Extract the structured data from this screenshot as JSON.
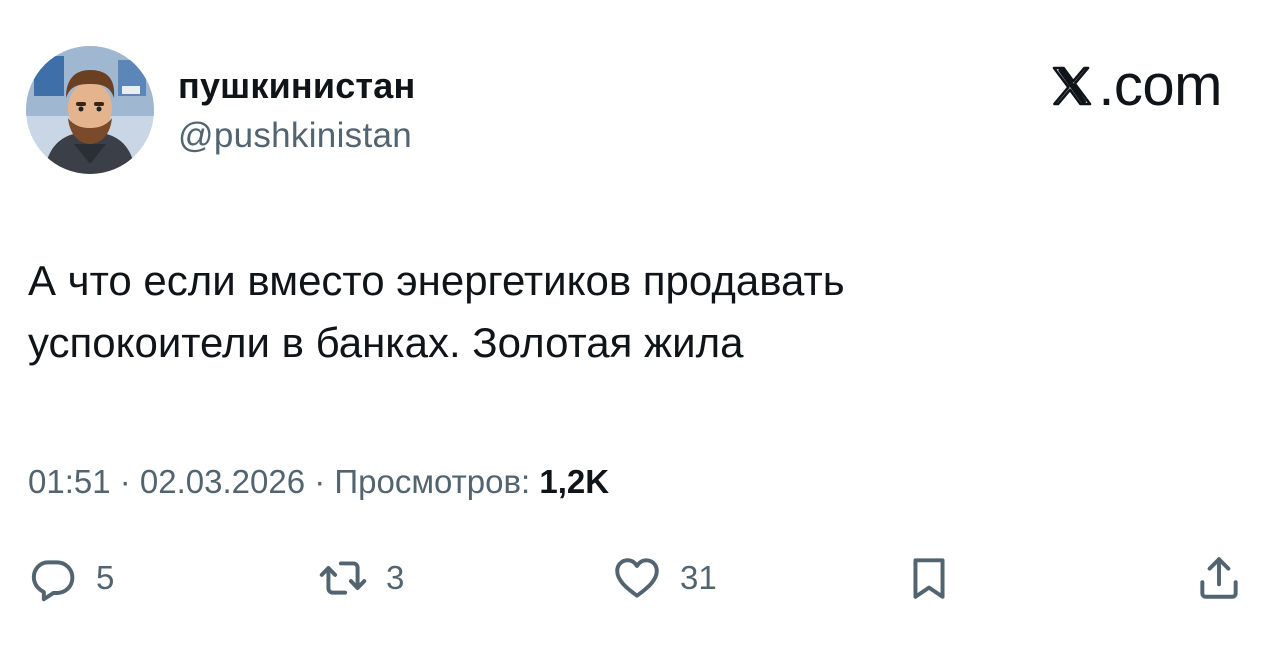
{
  "author": {
    "display_name": "пушкинистан",
    "handle": "@pushkinistan"
  },
  "brand": {
    "label": ".com",
    "icon": "x-logo-icon"
  },
  "tweet": {
    "text_lines": [
      "А что если вместо энергетиков продавать",
      "успокоители в банках. Золотая жила"
    ],
    "time": "01:51",
    "separator": " · ",
    "date": "02.03.2026",
    "views_label": "Просмотров:",
    "views_count": "1,2K"
  },
  "actions": {
    "reply": {
      "icon": "reply-icon",
      "count": "5"
    },
    "retweet": {
      "icon": "retweet-icon",
      "count": "3"
    },
    "like": {
      "icon": "heart-icon",
      "count": "31"
    },
    "bookmark": {
      "icon": "bookmark-icon"
    },
    "share": {
      "icon": "share-icon"
    }
  },
  "colors": {
    "text": "#0f1419",
    "secondary": "#536471",
    "background": "#ffffff"
  }
}
